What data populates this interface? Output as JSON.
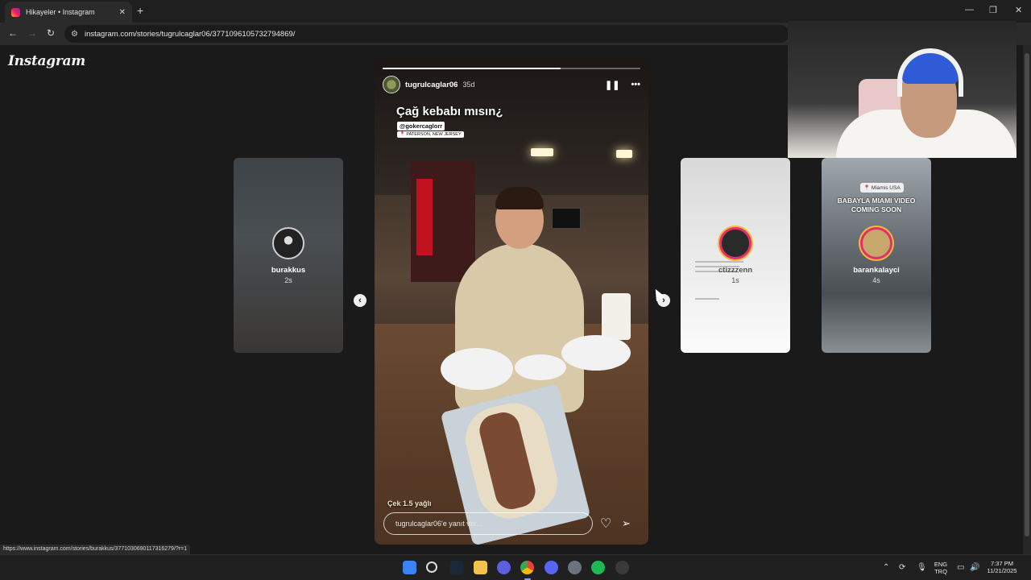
{
  "browser": {
    "tab_title": "Hikayeler • Instagram",
    "tab_close": "✕",
    "new_tab": "+",
    "url": "instagram.com/stories/tugrulcaglar06/3771096105732794869/",
    "window_controls": [
      "—",
      "❐",
      "✕"
    ],
    "status_url": "https://www.instagram.com/stories/burakkus/3771030690117316279/?r=1"
  },
  "page": {
    "logo": "Instagram"
  },
  "story": {
    "username": "tugrulcaglar06",
    "age": "35d",
    "progress": 0.69,
    "caption": "Çağ kebabı mısın¿",
    "mention": "@gokercaglorr",
    "location": "📍 PATERSON, NEW JERSEY",
    "price_text": "Çek 1.5 yağlı",
    "reply_placeholder": "tugrulcaglar06'e yanıt ver...",
    "pause_icon": "❚❚",
    "more_icon": "•••",
    "heart_icon": "♡",
    "send_icon": "➢"
  },
  "side_stories": [
    {
      "name": "burakkus",
      "age": "2s"
    },
    {
      "name": "ctizzzenn",
      "age": "1s"
    },
    {
      "name": "barankalayci",
      "age": "4s",
      "overlay_text": "BABAYLA MIAMI VIDEO COMING SOON",
      "location": "📍 Miamis USA"
    }
  ],
  "nav": {
    "prev_arrow": "‹",
    "next_arrow": "›"
  },
  "taskbar": {
    "lang_top": "ENG",
    "lang_bottom": "TRQ",
    "time": "7:37 PM",
    "date": "11/21/2025"
  },
  "colors": {
    "accent_ring": "#e1306c",
    "page_bg": "#1a1a1a"
  }
}
